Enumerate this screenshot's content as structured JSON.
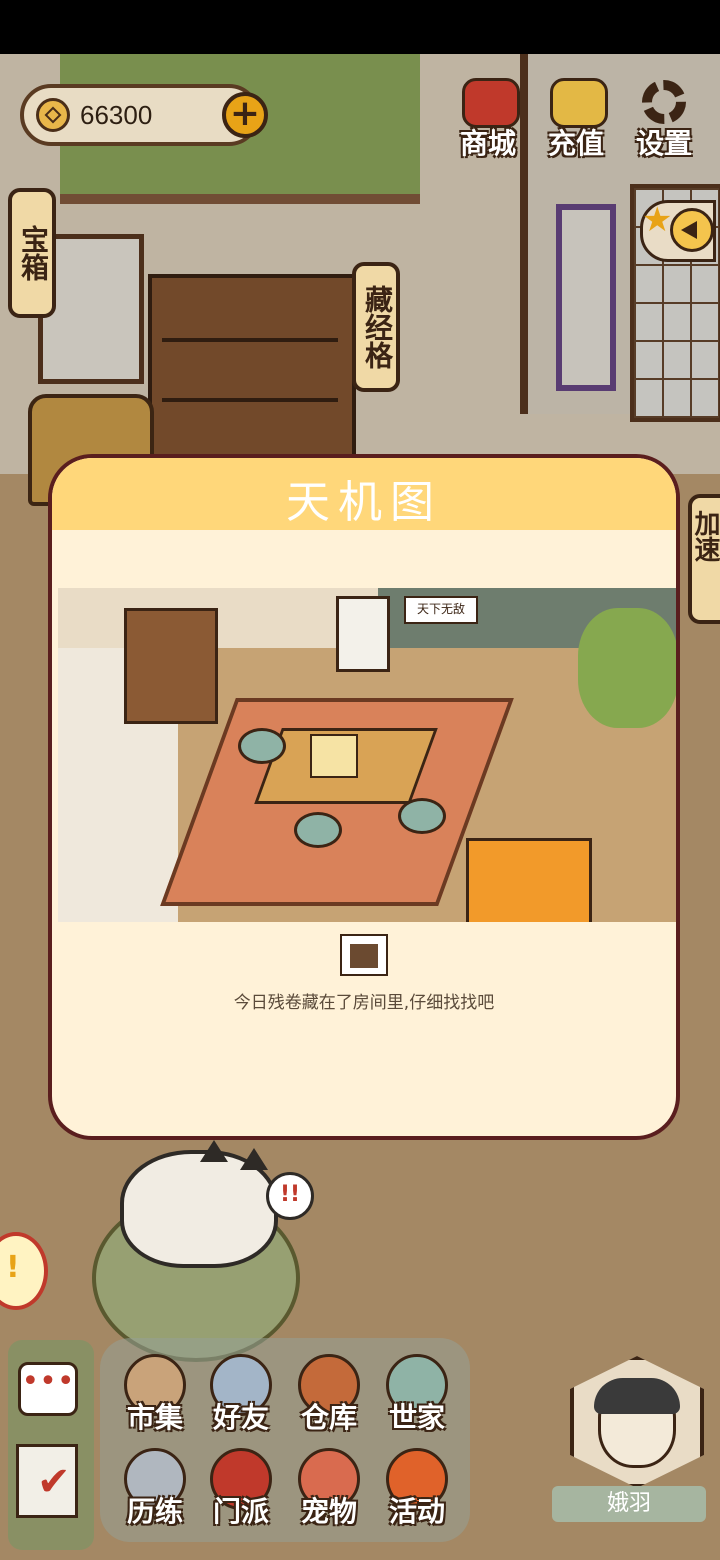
{
  "currency": {
    "value": "66300"
  },
  "top_buttons": {
    "shop": "商城",
    "recharge": "充值",
    "settings": "设置"
  },
  "labels": {
    "treasure": "宝箱",
    "library": "藏经格",
    "side_tab": "加速"
  },
  "modal": {
    "title": "天机图",
    "scene_sign": "天下无敌",
    "hint": "今日残卷藏在了房间里,仔细找找吧"
  },
  "menu": [
    {
      "label": "市集",
      "color": "#c9a37a"
    },
    {
      "label": "好友",
      "color": "#a3b5c8"
    },
    {
      "label": "仓库",
      "color": "#c46a3a"
    },
    {
      "label": "世家",
      "color": "#8fb3a6"
    },
    {
      "label": "历练",
      "color": "#b0b7bf"
    },
    {
      "label": "门派",
      "color": "#c0392b"
    },
    {
      "label": "宠物",
      "color": "#d96b4f"
    },
    {
      "label": "活动",
      "color": "#e0622a"
    }
  ],
  "avatar": {
    "name": "娥羽"
  },
  "notice": {
    "bubble": "!!",
    "orb": "!",
    "chat": "•••",
    "task": "✔"
  }
}
